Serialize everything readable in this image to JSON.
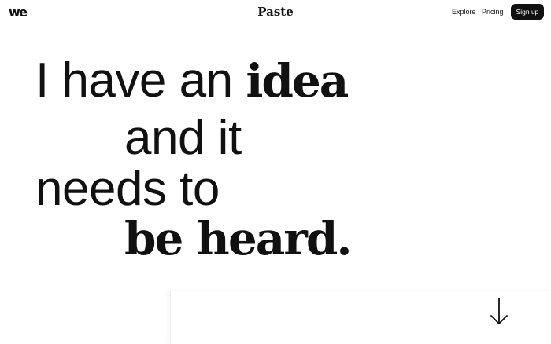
{
  "nav": {
    "logo": "we",
    "brand": "Paste",
    "explore": "Explore",
    "pricing": "Pricing",
    "signup": "Sign up"
  },
  "hero": {
    "line1_regular": "I have an ",
    "line1_bold": "idea",
    "line2": "and it",
    "line3": "needs to",
    "line4_bold": "be heard."
  },
  "icons": {
    "scroll": "arrow-down-icon"
  },
  "colors": {
    "text": "#111111",
    "background": "#ffffff",
    "button_bg": "#111111",
    "button_text": "#ffffff"
  }
}
